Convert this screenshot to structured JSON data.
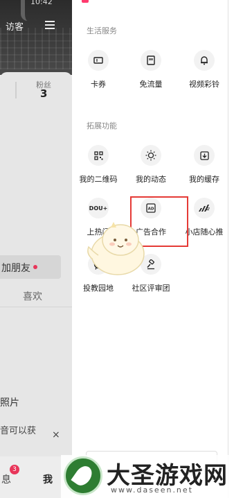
{
  "left_page": {
    "status_time": "10:42",
    "visitor_label": "访客",
    "fans_label": "粉丝",
    "fans_count": "3",
    "add_friend_label": "加朋友",
    "likes_tab": "喜欢",
    "photo_text": "照片",
    "earn_text": "音可以获",
    "close_icon": "×",
    "messages_label": "息",
    "messages_badge": "3",
    "me_label": "我"
  },
  "drawer": {
    "life_services_title": "生活服务",
    "life_services": [
      {
        "label": "卡券",
        "icon": "ticket-icon"
      },
      {
        "label": "免流量",
        "icon": "sim-card-icon"
      },
      {
        "label": "视频彩铃",
        "icon": "bell-icon"
      }
    ],
    "extensions_title": "拓展功能",
    "extensions": [
      {
        "label": "我的二维码",
        "icon": "qr-code-icon"
      },
      {
        "label": "我的动态",
        "icon": "sun-icon"
      },
      {
        "label": "我的缓存",
        "icon": "download-icon"
      },
      {
        "label": "上热门",
        "icon": "dou-plus-icon",
        "glyph": "DOU+"
      },
      {
        "label": "广告合作",
        "icon": "ad-icon",
        "glyph": "AD"
      },
      {
        "label": "小店随心推",
        "icon": "speed-icon"
      },
      {
        "label": "投教园地",
        "icon": "badge-icon"
      },
      {
        "label": "社区评审团",
        "icon": "gavel-icon"
      }
    ]
  },
  "watermark": {
    "title": "大圣游戏网",
    "url": "www.daseen.net"
  },
  "colors": {
    "highlight_border": "#e53935",
    "badge": "#e8365a",
    "logo_green": "#2e7d32"
  }
}
